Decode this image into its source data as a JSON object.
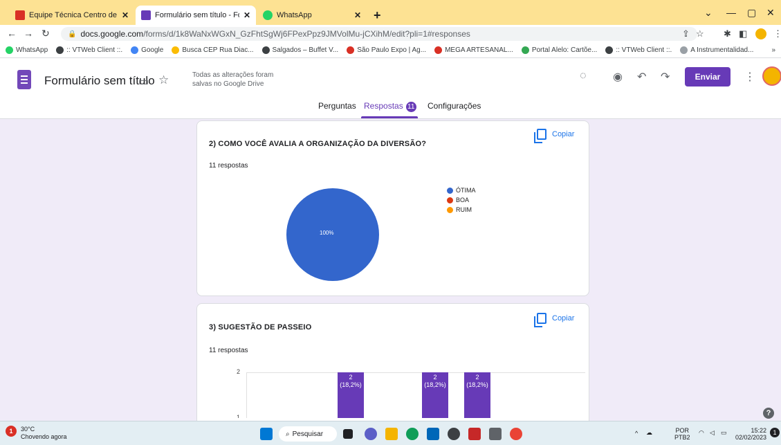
{
  "browser": {
    "tabs": [
      {
        "title": "Equipe Técnica Centro de Referê",
        "color": "#d93025"
      },
      {
        "title": "Formulário sem título - Formulári",
        "color": "#673ab7"
      },
      {
        "title": "WhatsApp",
        "color": "#25d366"
      }
    ],
    "url_host": "docs.google.com",
    "url_path": "/forms/d/1k8WaNxWGxN_GzFhtSgWj6FPexPpz9JMVolMu-jCXihM/edit?pli=1#responses",
    "bookmarks": [
      {
        "label": "WhatsApp",
        "color": "#25d366"
      },
      {
        "label": ":: VTWeb Client ::.",
        "color": "#3c4043"
      },
      {
        "label": "Google",
        "color": "#4285f4"
      },
      {
        "label": "Busca CEP Rua Diac...",
        "color": "#fbbc04"
      },
      {
        "label": "Salgados – Buffet V...",
        "color": "#3c4043"
      },
      {
        "label": "São Paulo Expo | Ag...",
        "color": "#d93025"
      },
      {
        "label": "MEGA ARTESANAL...",
        "color": "#d93025"
      },
      {
        "label": "Portal Alelo: Cartõe...",
        "color": "#34a853"
      },
      {
        "label": ":: VTWeb Client ::.",
        "color": "#3c4043"
      },
      {
        "label": "A Instrumentalidad...",
        "color": "#9aa0a6"
      }
    ],
    "bookmarks_more": "»"
  },
  "header": {
    "title": "Formulário sem título",
    "save_status": "Todas as alterações foram salvas no Google Drive",
    "send_label": "Enviar"
  },
  "nav": {
    "questions": "Perguntas",
    "responses": "Respostas",
    "responses_count": "11",
    "settings": "Configurações"
  },
  "copy_label": "Copiar",
  "q2": {
    "title": "2) COMO VOCÊ AVALIA A ORGANIZAÇÃO DA DIVERSÃO?",
    "count": "11 respostas",
    "legend": [
      {
        "label": "ÓTIMA",
        "color": "#3366cc"
      },
      {
        "label": "BOA",
        "color": "#dc3912"
      },
      {
        "label": "RUIM",
        "color": "#ff9900"
      }
    ],
    "pie_label": "100%"
  },
  "q3": {
    "title": "3) SUGESTÃO DE PASSEIO",
    "count": "11 respostas",
    "y_ticks": [
      "2",
      "1"
    ]
  },
  "chart_data": [
    {
      "type": "pie",
      "title": "2) COMO VOCÊ AVALIA A ORGANIZAÇÃO DA DIVERSÃO?",
      "categories": [
        "ÓTIMA",
        "BOA",
        "RUIM"
      ],
      "values": [
        11,
        0,
        0
      ],
      "data_labels": [
        "100%",
        "",
        ""
      ],
      "legend": "right"
    },
    {
      "type": "bar",
      "title": "3) SUGESTÃO DE PASSEIO",
      "values": [
        1,
        1,
        2,
        1,
        2,
        2,
        1,
        1
      ],
      "data_labels": [
        "",
        "",
        "2\n(18,2%)",
        "",
        "2\n(18,2%)",
        "2\n(18,2%)",
        "",
        ""
      ],
      "ylim": [
        1,
        2
      ],
      "grid": true
    }
  ],
  "taskbar": {
    "temperature": "30°C",
    "weather": "Chovendo agora",
    "weather_badge": "1",
    "search": "Pesquisar",
    "lang1": "POR",
    "lang2": "PTB2",
    "time": "15:22",
    "date": "02/02/2023",
    "notif": "1"
  }
}
